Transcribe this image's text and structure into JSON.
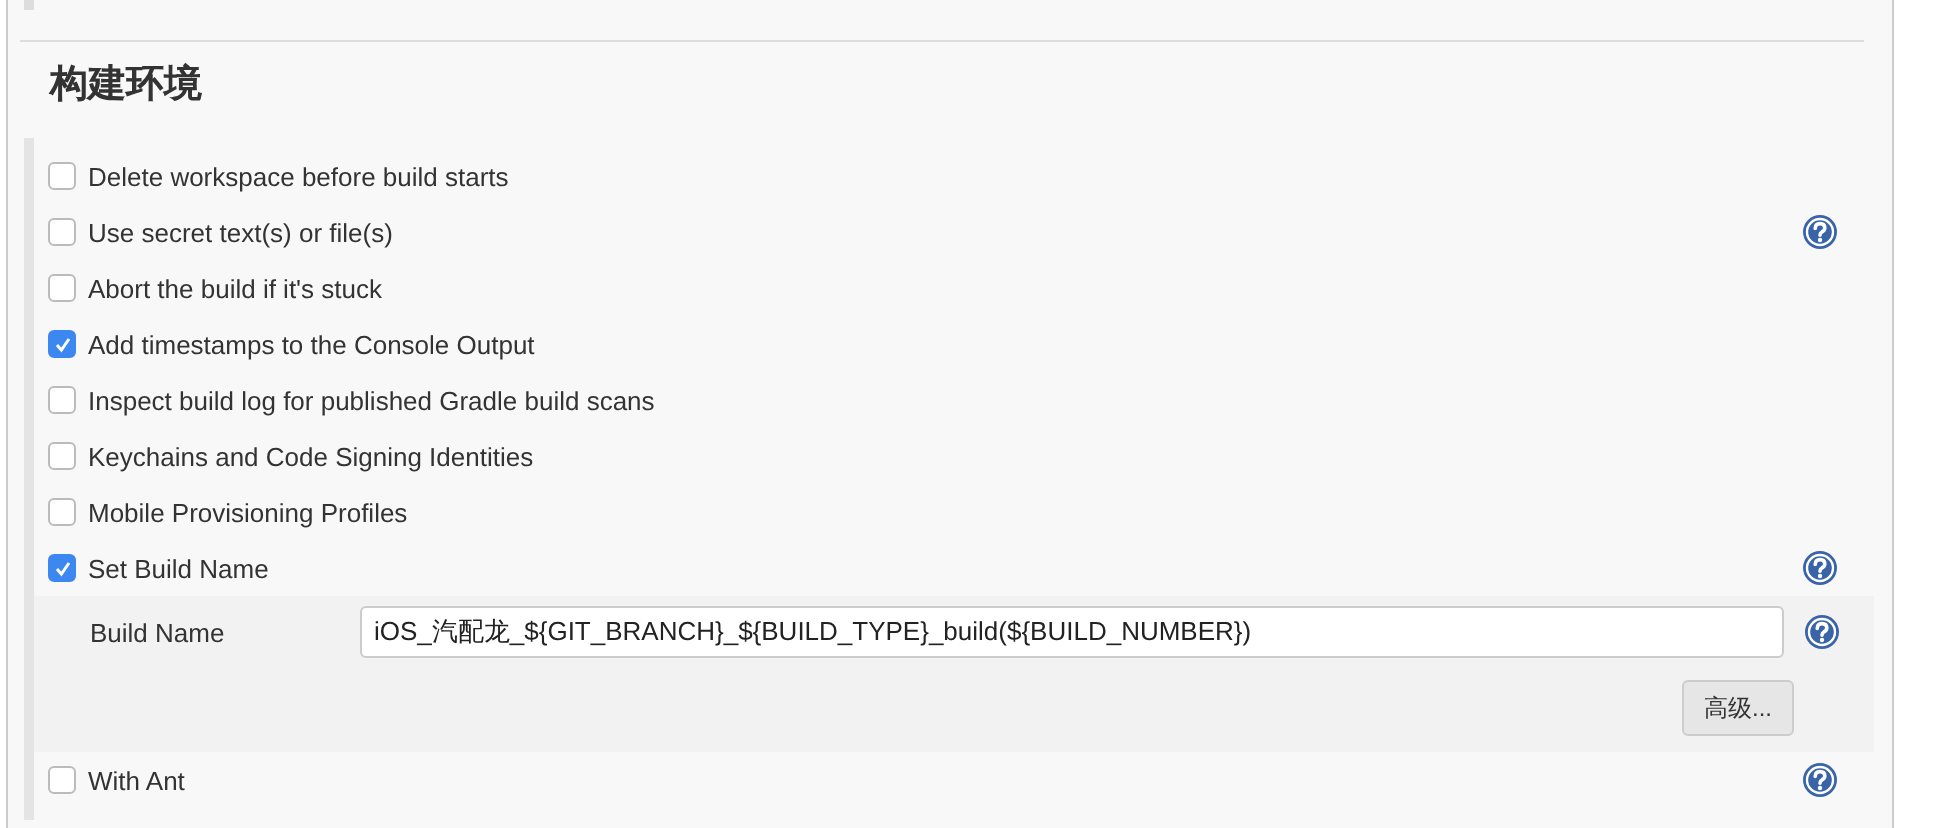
{
  "section_title": "构建环境",
  "options": [
    {
      "label": "Delete workspace before build starts",
      "checked": false,
      "help": false
    },
    {
      "label": "Use secret text(s) or file(s)",
      "checked": false,
      "help": true
    },
    {
      "label": "Abort the build if it's stuck",
      "checked": false,
      "help": false
    },
    {
      "label": "Add timestamps to the Console Output",
      "checked": true,
      "help": false
    },
    {
      "label": "Inspect build log for published Gradle build scans",
      "checked": false,
      "help": false
    },
    {
      "label": "Keychains and Code Signing Identities",
      "checked": false,
      "help": false
    },
    {
      "label": "Mobile Provisioning Profiles",
      "checked": false,
      "help": false
    },
    {
      "label": "Set Build Name",
      "checked": true,
      "help": true,
      "settings": {
        "label": "Build Name",
        "value": "iOS_汽配龙_${GIT_BRANCH}_${BUILD_TYPE}_build(${BUILD_NUMBER})",
        "help": true,
        "advanced_button": "高级..."
      }
    },
    {
      "label": "With Ant",
      "checked": false,
      "help": true
    }
  ]
}
